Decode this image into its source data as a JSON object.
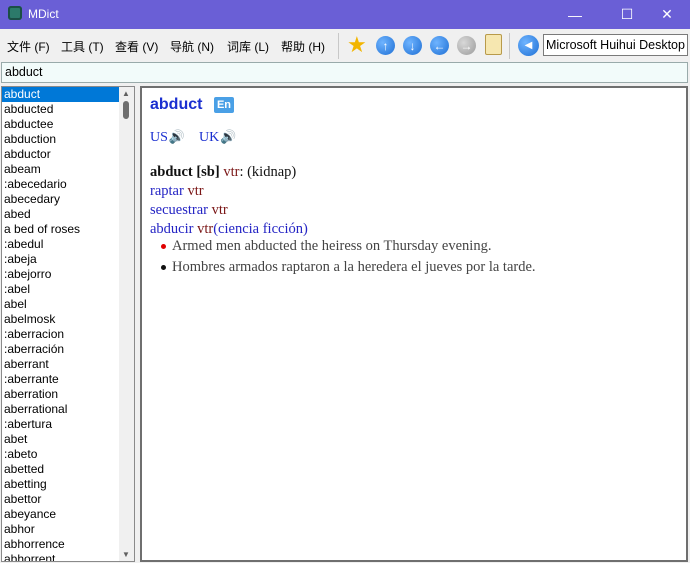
{
  "window": {
    "title": "MDict",
    "minimize": "—",
    "maximize": "☐",
    "close": "✕"
  },
  "menu": [
    "文件 (F)",
    "工具 (T)",
    "查看 (V)",
    "导航 (N)",
    "词库 (L)",
    "帮助 (H)"
  ],
  "toolbar": {
    "font": "Microsoft Huihui Desktop"
  },
  "search": {
    "value": "abduct"
  },
  "wordlist": [
    "abduct",
    "abducted",
    "abductee",
    "abduction",
    "abductor",
    "abeam",
    ":abecedario",
    "abecedary",
    "abed",
    "a bed of roses",
    ":abedul",
    ":abeja",
    ":abejorro",
    ":abel",
    "abel",
    "abelmosk",
    ":aberracion",
    ":aberración",
    "aberrant",
    ":aberrante",
    "aberration",
    "aberrational",
    ":abertura",
    "abet",
    ":abeto",
    "abetted",
    "abetting",
    "abettor",
    "abeyance",
    "abhor",
    "abhorrence",
    "abhorrent"
  ],
  "entry": {
    "headword": "abduct",
    "lang": "En",
    "us": "US",
    "uk": "UK",
    "speaker": "🔊",
    "sense_head": "abduct [sb]",
    "sense_pos": "vtr",
    "sense_colon": ":",
    "sense_gloss": "(kidnap)",
    "t1_word": "raptar",
    "t1_pos": "vtr",
    "t2_word": "secuestrar",
    "t2_pos": "vtr",
    "t3_word": "abducir",
    "t3_pos": "vtr",
    "t3_note": "(ciencia ficción)",
    "ex1": "Armed men abducted the heiress on Thursday evening.",
    "ex2": "Hombres armados raptaron a la heredera el jueves por la tarde."
  }
}
